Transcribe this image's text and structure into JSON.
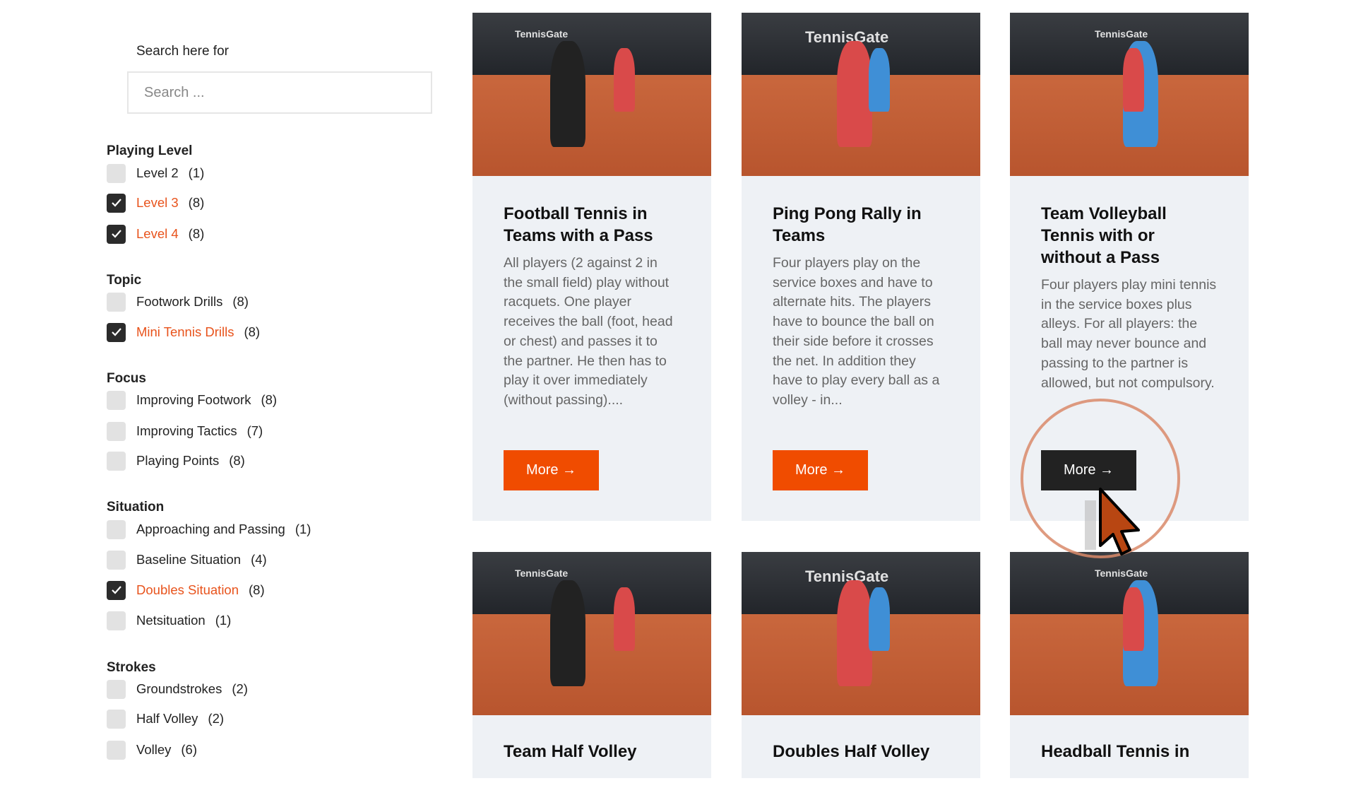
{
  "search": {
    "label": "Search here for",
    "placeholder": "Search ..."
  },
  "filters": [
    {
      "heading": "Playing Level",
      "items": [
        {
          "label": "Level 2",
          "count": "(1)",
          "checked": false
        },
        {
          "label": "Level 3",
          "count": "(8)",
          "checked": true
        },
        {
          "label": "Level 4",
          "count": "(8)",
          "checked": true
        }
      ]
    },
    {
      "heading": "Topic",
      "items": [
        {
          "label": "Footwork Drills",
          "count": "(8)",
          "checked": false
        },
        {
          "label": "Mini Tennis Drills",
          "count": "(8)",
          "checked": true
        }
      ]
    },
    {
      "heading": "Focus",
      "items": [
        {
          "label": "Improving Footwork",
          "count": "(8)",
          "checked": false
        },
        {
          "label": "Improving Tactics",
          "count": "(7)",
          "checked": false
        },
        {
          "label": "Playing Points",
          "count": "(8)",
          "checked": false
        }
      ]
    },
    {
      "heading": "Situation",
      "items": [
        {
          "label": "Approaching and Passing",
          "count": "(1)",
          "checked": false
        },
        {
          "label": "Baseline Situation",
          "count": "(4)",
          "checked": false
        },
        {
          "label": "Doubles Situation",
          "count": "(8)",
          "checked": true
        },
        {
          "label": "Netsituation",
          "count": "(1)",
          "checked": false
        }
      ]
    },
    {
      "heading": "Strokes",
      "items": [
        {
          "label": "Groundstrokes",
          "count": "(2)",
          "checked": false
        },
        {
          "label": "Half Volley",
          "count": "(2)",
          "checked": false
        },
        {
          "label": "Volley",
          "count": "(6)",
          "checked": false
        }
      ]
    }
  ],
  "cards": [
    {
      "title": "Football Tennis in Teams with a Pass",
      "desc": "All players (2 against 2 in the small field) play without racquets. One player receives the ball  (foot, head or chest) and passes it to the partner. He then has to play it over immediately (without passing)....",
      "button": "More →",
      "image_text": "TennisGate"
    },
    {
      "title": "Ping Pong Rally in Teams",
      "desc": "Four players play on the service boxes and have to alternate hits. The players have to bounce the ball on their side before it crosses the net. In addition they have to play every ball as a  volley - in...",
      "button": "More →",
      "image_text": "TennisGate"
    },
    {
      "title": "Team Volleyball Tennis with or without a Pass",
      "desc": "Four players play mini tennis in the service boxes plus alleys. For all players: the ball may never bounce and passing to the partner  is allowed, but not compulsory.",
      "button": "More →",
      "image_text": "TennisGate",
      "hovered": true
    }
  ],
  "cards_row2": [
    {
      "title": "Team Half Volley",
      "image_text": "TennisGate"
    },
    {
      "title": "Doubles Half Volley",
      "image_text": "TennisGate"
    },
    {
      "title": "Headball Tennis in",
      "image_text": "TennisGate"
    }
  ],
  "colors": {
    "accent": "#f04c00",
    "active_filter": "#e8531c",
    "card_bg": "#eef1f5",
    "button_hover": "#222222"
  }
}
